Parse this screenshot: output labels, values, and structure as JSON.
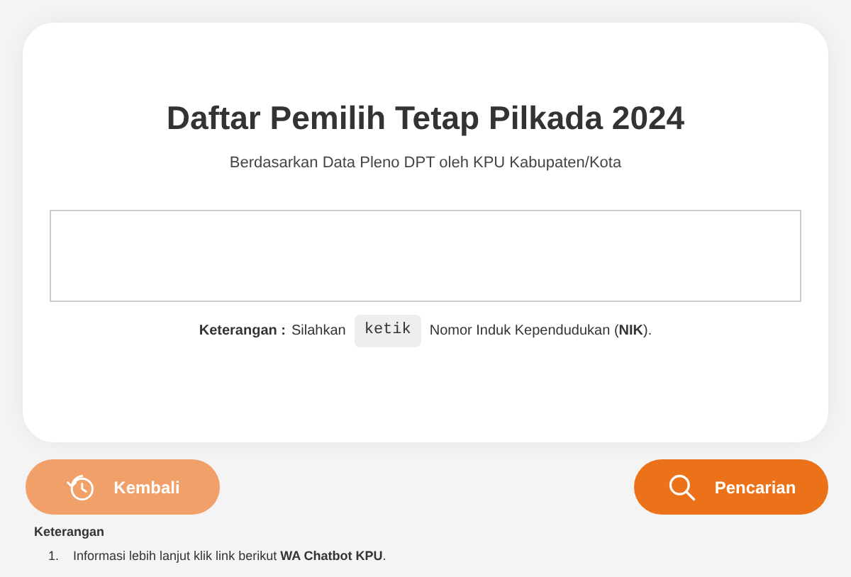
{
  "title": "Daftar Pemilih Tetap Pilkada 2024",
  "subtitle": "Berdasarkan Data Pleno DPT oleh KPU Kabupaten/Kota",
  "hint": {
    "label": "Keterangan :",
    "before": "Silahkan",
    "key": "ketik",
    "after": "Nomor Induk Kependudukan (**NIK**)."
  },
  "buttons": [
    {
      "kind": "back",
      "label": "Kembali",
      "disabled": true
    },
    {
      "kind": "search",
      "label": "Pencarian",
      "disabled": false
    }
  ],
  "notes": {
    "heading": "Keterangan",
    "items": [
      {
        "number": "1.",
        "text": "Informasi lebih lanjut klik link berikut **WA Chatbot KPU**."
      }
    ]
  }
}
